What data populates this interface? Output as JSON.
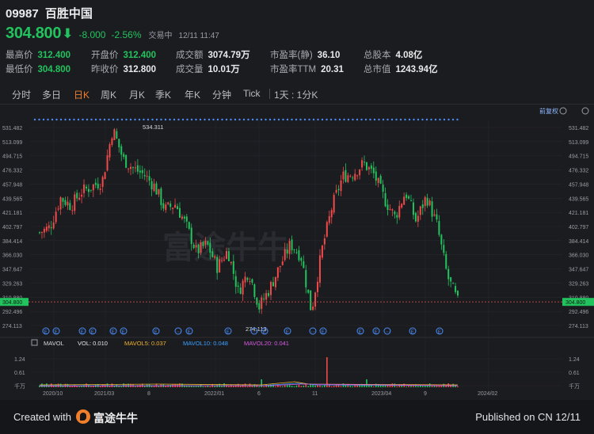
{
  "header": {
    "code": "09987",
    "name": "百胜中国",
    "price": "304.800",
    "change": "-8.000",
    "change_pct": "-2.56%",
    "status": "交易中",
    "time": "12/11 11:47",
    "colors": {
      "down": "#22c35e",
      "up": "#f04a4a",
      "accent": "#f07e2a"
    }
  },
  "stats": [
    {
      "label": "最高价",
      "value": "312.400",
      "color": "green"
    },
    {
      "label": "开盘价",
      "value": "312.400",
      "color": "green"
    },
    {
      "label": "成交额",
      "value": "3074.79万",
      "color": ""
    },
    {
      "label": "市盈率(静)",
      "value": "36.10",
      "color": ""
    },
    {
      "label": "总股本",
      "value": "4.08亿",
      "color": ""
    },
    {
      "label": "最低价",
      "value": "304.800",
      "color": "green"
    },
    {
      "label": "昨收价",
      "value": "312.800",
      "color": ""
    },
    {
      "label": "成交量",
      "value": "10.01万",
      "color": ""
    },
    {
      "label": "市盈率TTM",
      "value": "20.31",
      "color": ""
    },
    {
      "label": "总市值",
      "value": "1243.94亿",
      "color": ""
    }
  ],
  "tabs": [
    {
      "label": "分时",
      "active": false
    },
    {
      "label": "多日",
      "active": false
    },
    {
      "label": "日K",
      "active": true
    },
    {
      "label": "周K",
      "active": false
    },
    {
      "label": "月K",
      "active": false
    },
    {
      "label": "季K",
      "active": false
    },
    {
      "label": "年K",
      "active": false
    },
    {
      "label": "分钟",
      "active": false
    },
    {
      "label": "Tick",
      "active": false
    }
  ],
  "timeframe": "1天 : 1分K",
  "adjust_label": "前复权",
  "watermark": "富途牛牛",
  "chart_data": {
    "type": "candlestick",
    "y_ticks": [
      "531.482",
      "513.099",
      "494.715",
      "476.332",
      "457.948",
      "439.565",
      "421.181",
      "402.797",
      "384.414",
      "366.030",
      "347.647",
      "329.263",
      "310.880",
      "292.496",
      "274.113"
    ],
    "current_price_tag": "304.800",
    "high_label": "534.311",
    "low_label": "274.113",
    "x_ticks": [
      "2020/10",
      "2021/03",
      "8",
      "2022/01",
      "6",
      "11",
      "2023/04",
      "9",
      "2024/02"
    ],
    "ylim": [
      274.113,
      531.482
    ],
    "close_path": [
      [
        "2020/08",
        395
      ],
      [
        "2020/09",
        402
      ],
      [
        "2020/10",
        440
      ],
      [
        "2020/11",
        430
      ],
      [
        "2020/12",
        448
      ],
      [
        "2021/01",
        455
      ],
      [
        "2021/02",
        462
      ],
      [
        "2021/03",
        530
      ],
      [
        "2021/04",
        490
      ],
      [
        "2021/05",
        478
      ],
      [
        "2021/06",
        470
      ],
      [
        "2021/07",
        455
      ],
      [
        "2021/08",
        425
      ],
      [
        "2021/09",
        432
      ],
      [
        "2021/10",
        405
      ],
      [
        "2021/11",
        370
      ],
      [
        "2021/12",
        380
      ],
      [
        "2022/01",
        350
      ],
      [
        "2022/02",
        372
      ],
      [
        "2022/03",
        318
      ],
      [
        "2022/04",
        345
      ],
      [
        "2022/05",
        298
      ],
      [
        "2022/06",
        322
      ],
      [
        "2022/07",
        352
      ],
      [
        "2022/08",
        380
      ],
      [
        "2022/09",
        365
      ],
      [
        "2022/10",
        292
      ],
      [
        "2022/11",
        372
      ],
      [
        "2022/12",
        430
      ],
      [
        "2023/01",
        468
      ],
      [
        "2023/02",
        472
      ],
      [
        "2023/03",
        485
      ],
      [
        "2023/04",
        470
      ],
      [
        "2023/05",
        438
      ],
      [
        "2023/06",
        415
      ],
      [
        "2023/07",
        448
      ],
      [
        "2023/08",
        410
      ],
      [
        "2023/09",
        442
      ],
      [
        "2023/10",
        405
      ],
      [
        "2023/11",
        338
      ],
      [
        "2023/12",
        305
      ]
    ],
    "event_dots_top": 45,
    "event_markers": [
      "E",
      "E",
      "E",
      "E",
      "E",
      "E",
      "E",
      "D",
      "E",
      "E",
      "D",
      "E",
      "E",
      "D",
      "E",
      "E",
      "E",
      "D",
      "E",
      "E"
    ]
  },
  "volume": {
    "labels": {
      "period": "MAVOL",
      "vol": "VOL: 0.010",
      "ma5": "MAVOL5: 0.037",
      "ma10": "MAVOL10: 0.048",
      "ma20": "MAVOL20: 0.041"
    },
    "y_ticks": [
      "1.24",
      "0.61",
      "千万"
    ],
    "colors": {
      "vol": "#e8e8e8",
      "ma5": "#f0b429",
      "ma10": "#3aa0ff",
      "ma20": "#d65ae0"
    }
  },
  "footer": {
    "created": "Created with",
    "brand": "富途牛牛",
    "published": "Published on CN 12/11"
  }
}
